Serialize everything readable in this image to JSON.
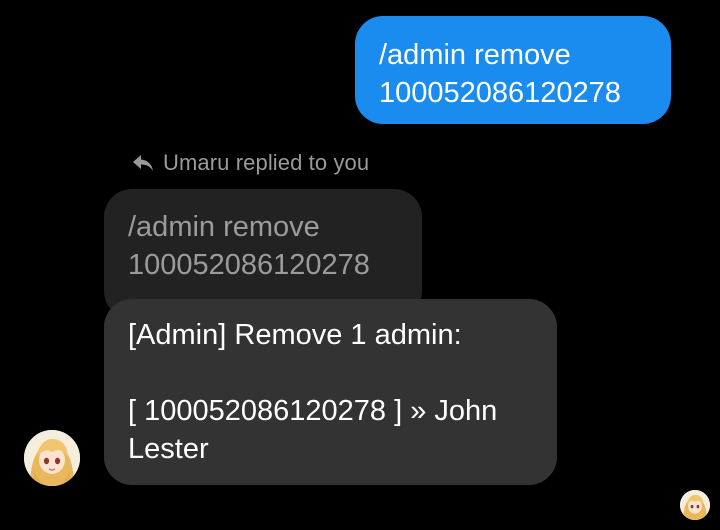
{
  "sent_message": {
    "text": "/admin remove\n100052086120278",
    "bubble_color": "#1a8cf0"
  },
  "reply_indicator": {
    "icon": "reply-arrow-icon",
    "text": "Umaru replied to you"
  },
  "quoted_message": {
    "text": "/admin remove\n100052086120278"
  },
  "received_message": {
    "lines": [
      "[Admin] Remove 1 admin:",
      "",
      "[ 100052086120278 ] » John",
      "Lester"
    ],
    "bubble_color": "#333333"
  },
  "avatars": {
    "sender": "umaru-avatar",
    "read_receipt": "read-receipt-avatar"
  }
}
